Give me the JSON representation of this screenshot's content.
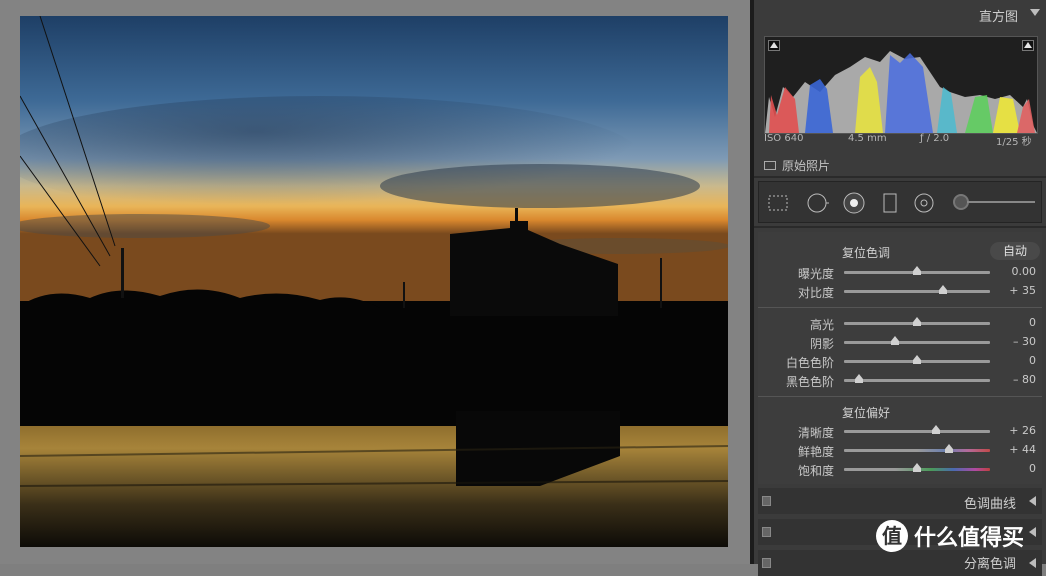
{
  "panel": {
    "histogram_title": "直方图",
    "camera_info": {
      "iso": "ISO 640",
      "focal": "4.5 mm",
      "aperture": "ƒ / 2.0",
      "shutter": "1/25 秒"
    },
    "original_photo_label": "原始照片"
  },
  "basic": {
    "tone_reset": "复位色调",
    "auto_button": "自动",
    "tone_rows": [
      {
        "label": "曝光度",
        "value": "0.00",
        "pos": 0.5
      },
      {
        "label": "对比度",
        "value": "+ 35",
        "pos": 0.675
      }
    ],
    "light_rows": [
      {
        "label": "高光",
        "value": "0",
        "pos": 0.5
      },
      {
        "label": "阴影",
        "value": "– 30",
        "pos": 0.35
      },
      {
        "label": "白色色阶",
        "value": "0",
        "pos": 0.5
      },
      {
        "label": "黑色色阶",
        "value": "– 80",
        "pos": 0.1
      }
    ],
    "presence_reset": "复位偏好",
    "presence_rows": [
      {
        "label": "清晰度",
        "value": "+ 26",
        "pos": 0.63
      },
      {
        "label": "鲜艳度",
        "value": "+ 44",
        "pos": 0.72
      },
      {
        "label": "饱和度",
        "value": "0",
        "pos": 0.5
      }
    ]
  },
  "bottom_panels": [
    {
      "title": "色调曲线"
    },
    {
      "title": ""
    },
    {
      "title": "分离色调"
    }
  ],
  "watermark": {
    "icon": "值",
    "text": "什么值得买"
  }
}
